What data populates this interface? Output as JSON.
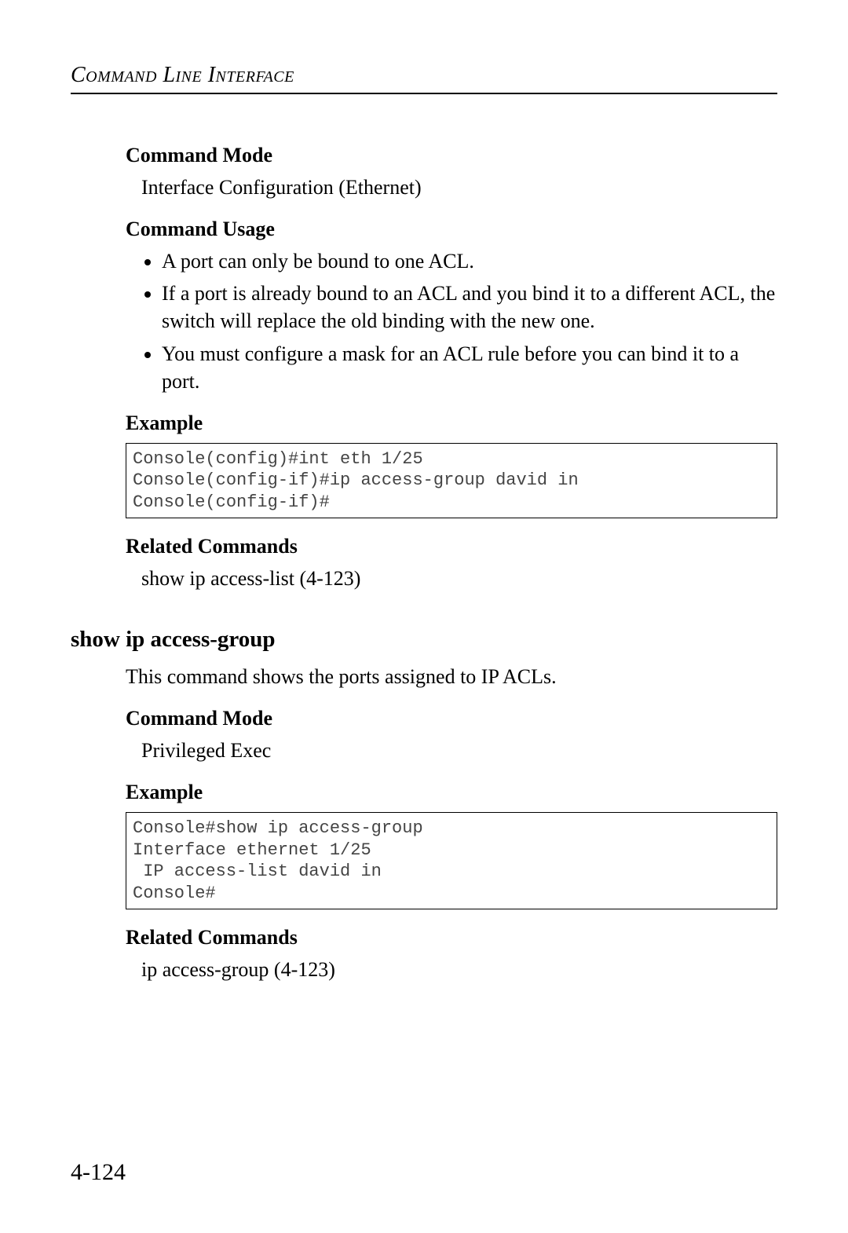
{
  "header": {
    "chapter_title": "Command Line Interface"
  },
  "section1": {
    "cmd_mode_label": "Command Mode",
    "cmd_mode_text": "Interface Configuration (Ethernet)",
    "cmd_usage_label": "Command Usage",
    "usage_items": [
      "A port can only be bound to one ACL.",
      "If a port is already bound to an ACL and you bind it to a different ACL, the switch will replace the old binding with the new one.",
      "You must configure a mask for an ACL rule before you can bind it to a port."
    ],
    "example_label": "Example",
    "example_code": "Console(config)#int eth 1/25\nConsole(config-if)#ip access-group david in\nConsole(config-if)#",
    "related_label": "Related Commands",
    "related_text": "show ip access-list (4-123)"
  },
  "section2": {
    "heading": "show ip access-group",
    "description": "This command shows the ports assigned to IP ACLs.",
    "cmd_mode_label": "Command Mode",
    "cmd_mode_text": "Privileged Exec",
    "example_label": "Example",
    "example_code": "Console#show ip access-group\nInterface ethernet 1/25\n IP access-list david in\nConsole#",
    "related_label": "Related Commands",
    "related_text": "ip access-group (4-123)"
  },
  "footer": {
    "page_number": "4-124"
  }
}
